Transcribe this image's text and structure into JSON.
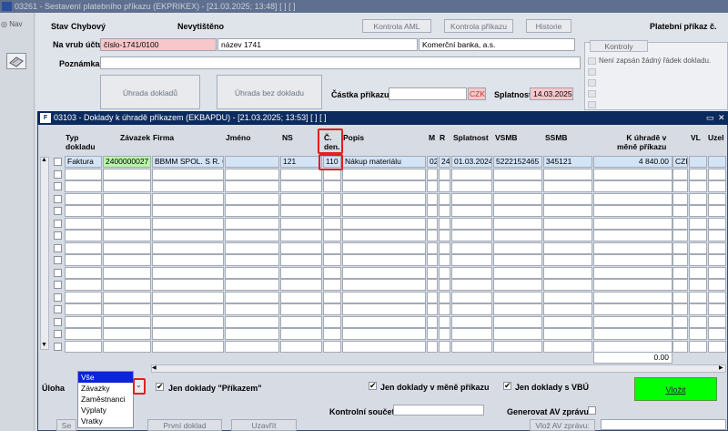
{
  "bg_window": {
    "title": "03261 - Sestavení platebního příkazu (EKPRIKEX) - [21.03.2025; 13:48] [ ] [ ]",
    "nav_label": "Nav"
  },
  "form": {
    "stav_label": "Stav",
    "stav_value": "Chybový",
    "nevytisteno": "Nevytištěno",
    "btn_kontrola_aml": "Kontrola AML",
    "btn_kontrola_prikazu": "Kontrola příkazu",
    "btn_historie": "Historie",
    "platebni_prikaz": "Platební příkaz č.",
    "na_vrub_label": "Na vrub účtu",
    "na_vrub_value": "číslo-1741/0100",
    "nazev_value": "název 1741",
    "banka_value": "Komerční banka, a.s.",
    "poznamka_label": "Poznámka",
    "poznamka_value": "",
    "btn_uhrada_dokladu": "Úhrada dokladů",
    "btn_uhrada_bez": "Úhrada bez dokladu",
    "castka_label": "Částka příkazu",
    "castka_value": "",
    "currency": "CZK",
    "splatnost_label": "Splatnost",
    "splatnost_value": "14.03.2025",
    "kontroly_tab": "Kontroly",
    "kontroly_msg": "Není zapsán žádný řádek dokladu."
  },
  "dialog": {
    "title": "03103 - Doklady k úhradě příkazem (EKBAPDU) - [21.03.2025; 13:53] [ ] [ ]",
    "ctrl_restore": "▭",
    "ctrl_close": "✕",
    "columns": {
      "typ": "Typ",
      "typ2": "dokladu",
      "zavazek": "Závazek",
      "firma": "Firma",
      "jmeno": "Jméno",
      "ns": "NS",
      "cden": "Č.",
      "cden2": "den.",
      "popis": "Popis",
      "m": "M",
      "r": "R",
      "splatnost": "Splatnost",
      "vsmb": "VSMB",
      "ssmb": "SSMB",
      "kuhrade": "K úhradě v",
      "kuhrade2": "měně příkazu",
      "vl": "VL",
      "uzel": "Uzel"
    },
    "row": {
      "typ": "Faktura",
      "zavazek": "2400000027",
      "firma": "BBMM SPOL. S R. O.",
      "jmeno": "",
      "ns": "121",
      "cden": "110",
      "popis": "Nákup materiálu",
      "m": "02",
      "r": "24",
      "splatnost": "01.03.2024",
      "vsmb": "5222152465",
      "ssmb": "345121",
      "kuhrade": "4 840.00",
      "vl": "CZK"
    },
    "total": "0.00",
    "uloha_label": "Úloha",
    "options": [
      "Vše",
      "Závazky",
      "Zaměstnanci",
      "Výplaty",
      "Vratky"
    ],
    "chk_prikazem": "Jen doklady \"Příkazem\"",
    "chk_mene": "Jen doklady v měně příkazu",
    "chk_vbu": "Jen doklady s VBÚ",
    "btn_vlozit": "Vložit"
  },
  "footer": {
    "kontrolni_soucet": "Kontrolní součet",
    "generovat_av": "Generovat AV zprávu",
    "btn_se": "Se",
    "btn_prvni": "První doklad",
    "btn_uzavrit": "Uzavřít",
    "vloz_av": "Vlož AV zprávu:"
  }
}
